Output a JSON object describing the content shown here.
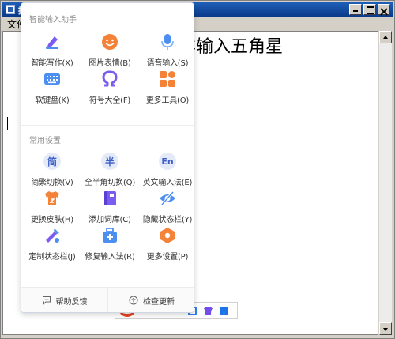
{
  "window": {
    "title": "拼",
    "menu_first": "文件",
    "editor_text": "人样输入五角星"
  },
  "panel": {
    "section1_title": "智能输入助手",
    "section2_title": "常用设置",
    "section1_items": [
      {
        "label": "智能写作(X)",
        "icon": "pen-icon"
      },
      {
        "label": "图片表情(B)",
        "icon": "smile-icon"
      },
      {
        "label": "语音输入(S)",
        "icon": "microphone-icon"
      },
      {
        "label": "软键盘(K)",
        "icon": "keyboard-icon"
      },
      {
        "label": "符号大全(F)",
        "icon": "omega-icon"
      },
      {
        "label": "更多工具(O)",
        "icon": "tools-grid-icon"
      }
    ],
    "section2_items": [
      {
        "label": "简繁切换(V)",
        "icon": "simplified-icon",
        "glyph": "简"
      },
      {
        "label": "全半角切换(Q)",
        "icon": "half-width-icon",
        "glyph": "半"
      },
      {
        "label": "英文输入法(E)",
        "icon": "english-icon",
        "glyph": "En"
      },
      {
        "label": "更换皮肤(H)",
        "icon": "shirt-icon"
      },
      {
        "label": "添加词库(C)",
        "icon": "book-icon"
      },
      {
        "label": "隐藏状态栏(Y)",
        "icon": "eye-hidden-icon"
      },
      {
        "label": "定制状态栏(J)",
        "icon": "wrench-icon"
      },
      {
        "label": "修复输入法(R)",
        "icon": "toolbox-icon"
      },
      {
        "label": "更多设置(P)",
        "icon": "settings-hex-icon"
      }
    ],
    "footer": {
      "help_label": "帮助反馈",
      "update_label": "检查更新"
    }
  },
  "colors": {
    "accent_blue": "#3f60c8",
    "orange": "#f4833a",
    "purple": "#7b5cf0",
    "sky": "#4d8ff0"
  }
}
